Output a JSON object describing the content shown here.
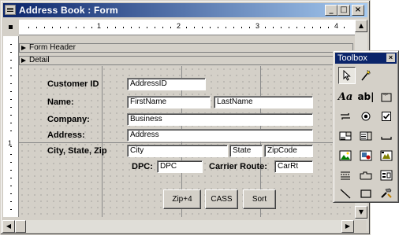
{
  "window": {
    "title": "Address Book : Form"
  },
  "ruler": {
    "numbers": [
      "1",
      "2",
      "3",
      "4"
    ]
  },
  "vruler": {
    "number": "1"
  },
  "sections": {
    "form_header": "Form Header",
    "detail": "Detail"
  },
  "fields": {
    "customer_id": {
      "label": "Customer ID",
      "value": "AddressID"
    },
    "name": {
      "label": "Name:",
      "first": "FirstName",
      "last": "LastName"
    },
    "company": {
      "label": "Company:",
      "value": "Business"
    },
    "address": {
      "label": "Address:",
      "value": "Address"
    },
    "city_state_zip": {
      "label": "City, State, Zip",
      "city": "City",
      "state": "State",
      "zip": "ZipCode"
    },
    "dpc": {
      "label": "DPC:",
      "value": "DPC"
    },
    "carrier_route": {
      "label": "Carrier Route:",
      "value": "CarRt"
    }
  },
  "buttons": {
    "zip4": "Zip+4",
    "cass": "CASS",
    "sort": "Sort"
  },
  "toolbox": {
    "title": "Toolbox",
    "tools": [
      "select-objects",
      "control-wizards",
      "label",
      "text-box",
      "option-group",
      "toggle-button",
      "option-button",
      "check-box",
      "combo-box",
      "list-box",
      "command-button",
      "image",
      "unbound-object-frame",
      "bound-object-frame",
      "page-break",
      "tab-control",
      "subform",
      "line",
      "rectangle",
      "more-controls"
    ]
  },
  "colors": {
    "title_bar_start": "#0a246a",
    "title_bar_end": "#a6caf0",
    "face": "#d4d0c8"
  }
}
